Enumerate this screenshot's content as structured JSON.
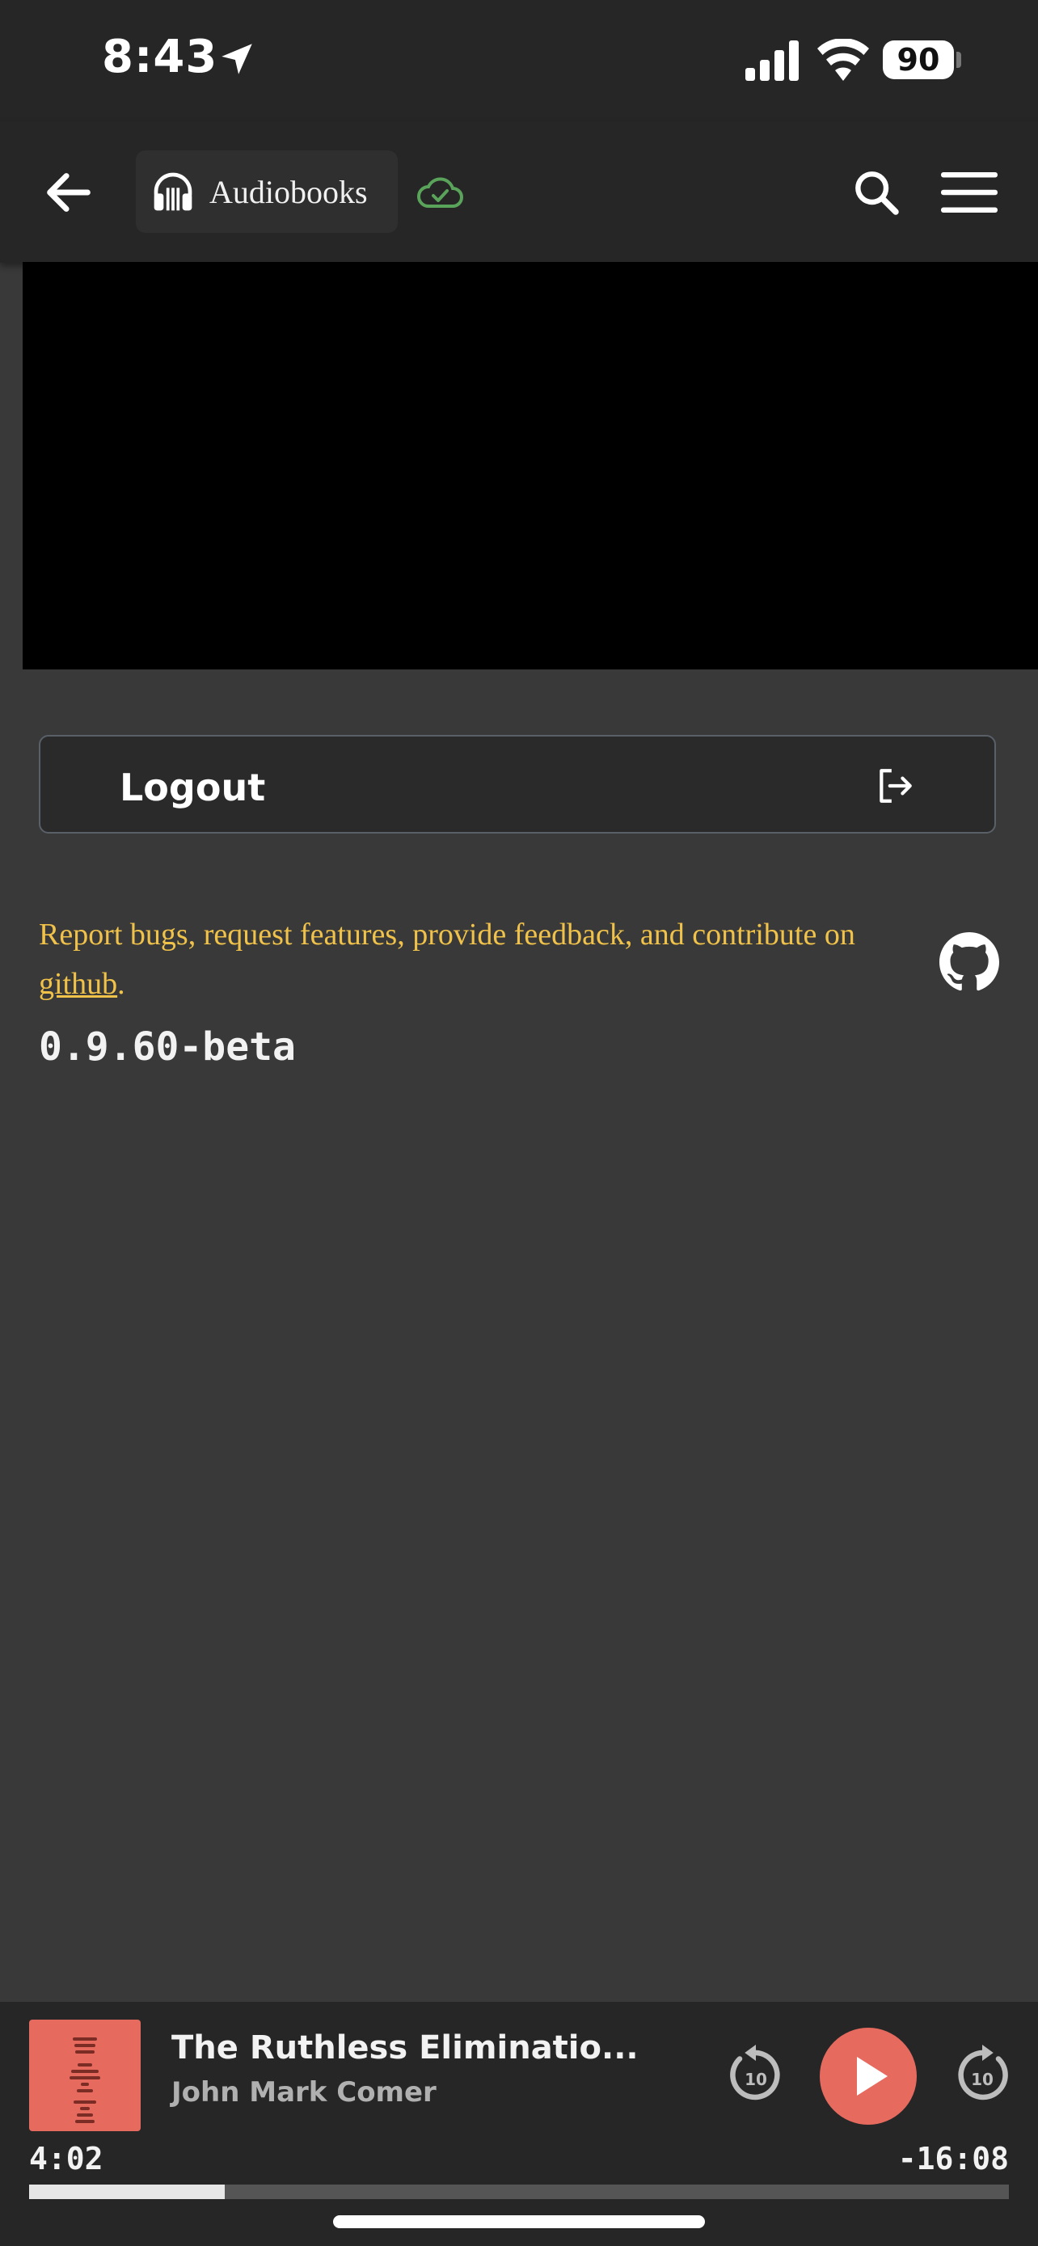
{
  "status_bar": {
    "time": "8:43",
    "battery": "90",
    "icons": [
      "location-arrow-icon",
      "cellular-signal-icon",
      "wifi-icon",
      "battery-icon"
    ]
  },
  "app_bar": {
    "library_label": "Audiobooks",
    "icons": [
      "back-arrow-icon",
      "headphones-icon",
      "cloud-check-icon",
      "search-icon",
      "hamburger-menu-icon"
    ],
    "cloud_color": "#5aa35a"
  },
  "settings": {
    "logout_label": "Logout",
    "feedback_prefix": "Report bugs, request features, provide feedback, and contribute on ",
    "feedback_link": "github",
    "feedback_suffix": ".",
    "version": "0.9.60-beta"
  },
  "player": {
    "title": "The Ruthless Eliminatio...",
    "author": "John Mark Comer",
    "elapsed": "4:02",
    "remaining": "-16:08",
    "rewind_seconds": "10",
    "forward_seconds": "10",
    "progress": 0.2,
    "accent": "#e76a5f"
  },
  "colors": {
    "background": "#393939",
    "bar": "#262626",
    "link": "#f0c24a"
  }
}
